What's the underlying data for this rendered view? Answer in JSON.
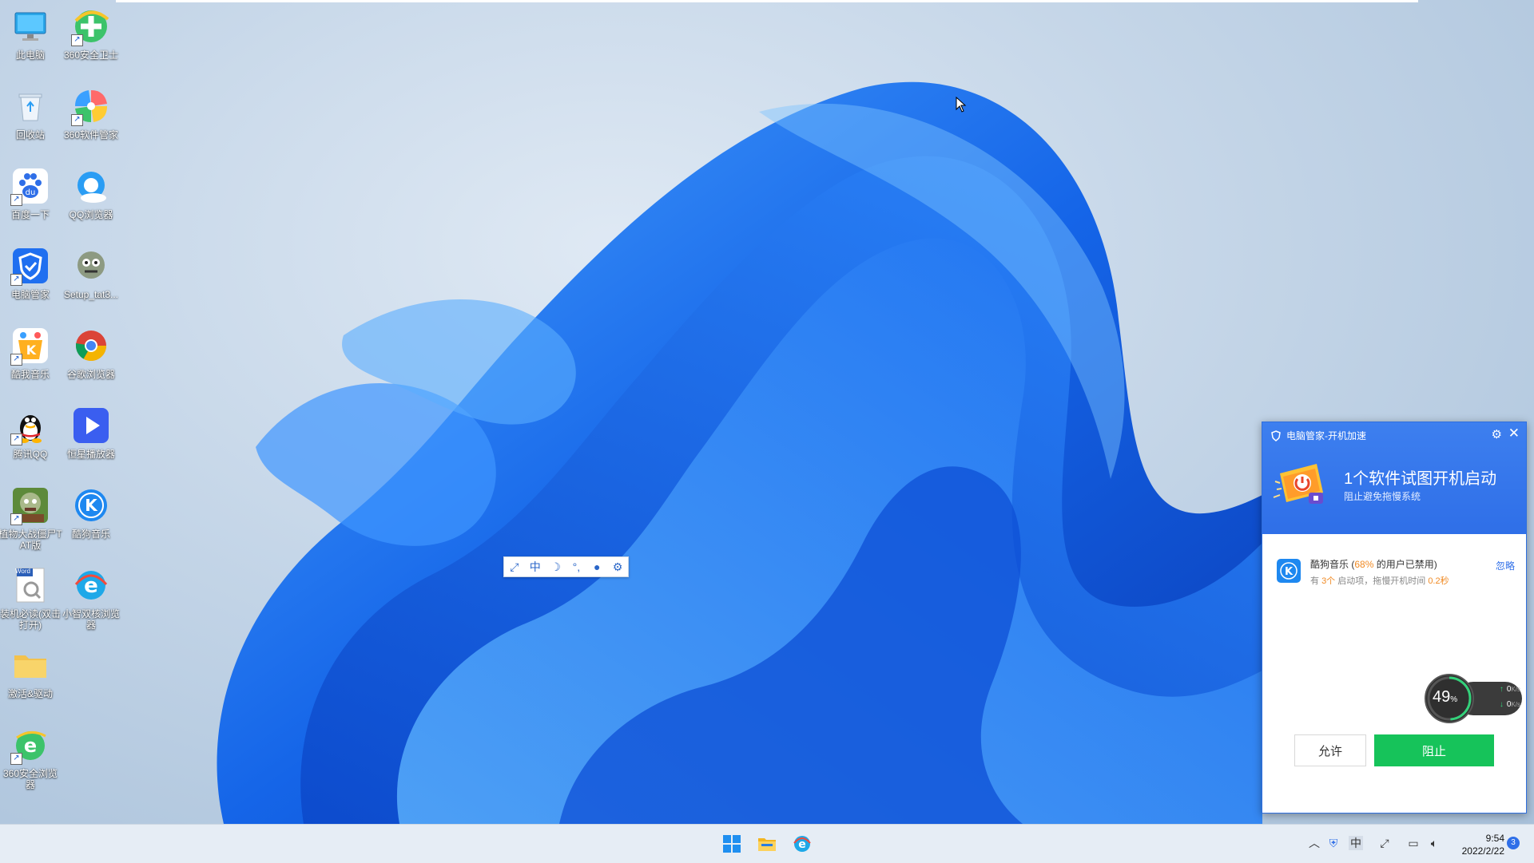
{
  "desktop": {
    "icons": [
      {
        "label": "此电脑"
      },
      {
        "label": "360安全卫士"
      },
      {
        "label": "回收站"
      },
      {
        "label": "360软件管家"
      },
      {
        "label": "百度一下"
      },
      {
        "label": "QQ浏览器"
      },
      {
        "label": "电脑管家"
      },
      {
        "label": "Setup_tat3..."
      },
      {
        "label": "酷我音乐"
      },
      {
        "label": "谷歌浏览器"
      },
      {
        "label": "腾讯QQ"
      },
      {
        "label": "恒星播放器"
      },
      {
        "label": "植物大战僵尸TAT版"
      },
      {
        "label": "酷狗音乐"
      },
      {
        "label": "装机必读(双击打开)"
      },
      {
        "label": "小智双核浏览器"
      },
      {
        "label": "激活&驱动"
      },
      {
        "label": "360安全浏览器"
      }
    ],
    "word_badge": "Word"
  },
  "ime_bar": {
    "language": "中"
  },
  "popup": {
    "title": "电脑管家-开机加速",
    "headline": "1个软件试图开机启动",
    "subtitle": "阻止避免拖慢系统",
    "app": {
      "name": "酷狗音乐",
      "disabled_pre": " (",
      "disabled_pct": "68%",
      "disabled_post": " 的用户已禁用)",
      "info_pre": "有 ",
      "info_count": "3个",
      "info_mid": " 启动项，拖慢开机时间 ",
      "info_time": "0.2秒",
      "ignore": "忽略"
    },
    "allow": "允许",
    "block": "阻止",
    "colors": {
      "header": "#2f6fe8",
      "block": "#16c35a",
      "highlight": "#f08a24"
    }
  },
  "gauge": {
    "value": "49",
    "unit": "%",
    "fraction": 0.49,
    "upload": "0",
    "download": "0",
    "speed_unit": "K/s"
  },
  "taskbar": {
    "time": "9:54",
    "date": "2022/2/22",
    "notifications": "3"
  }
}
